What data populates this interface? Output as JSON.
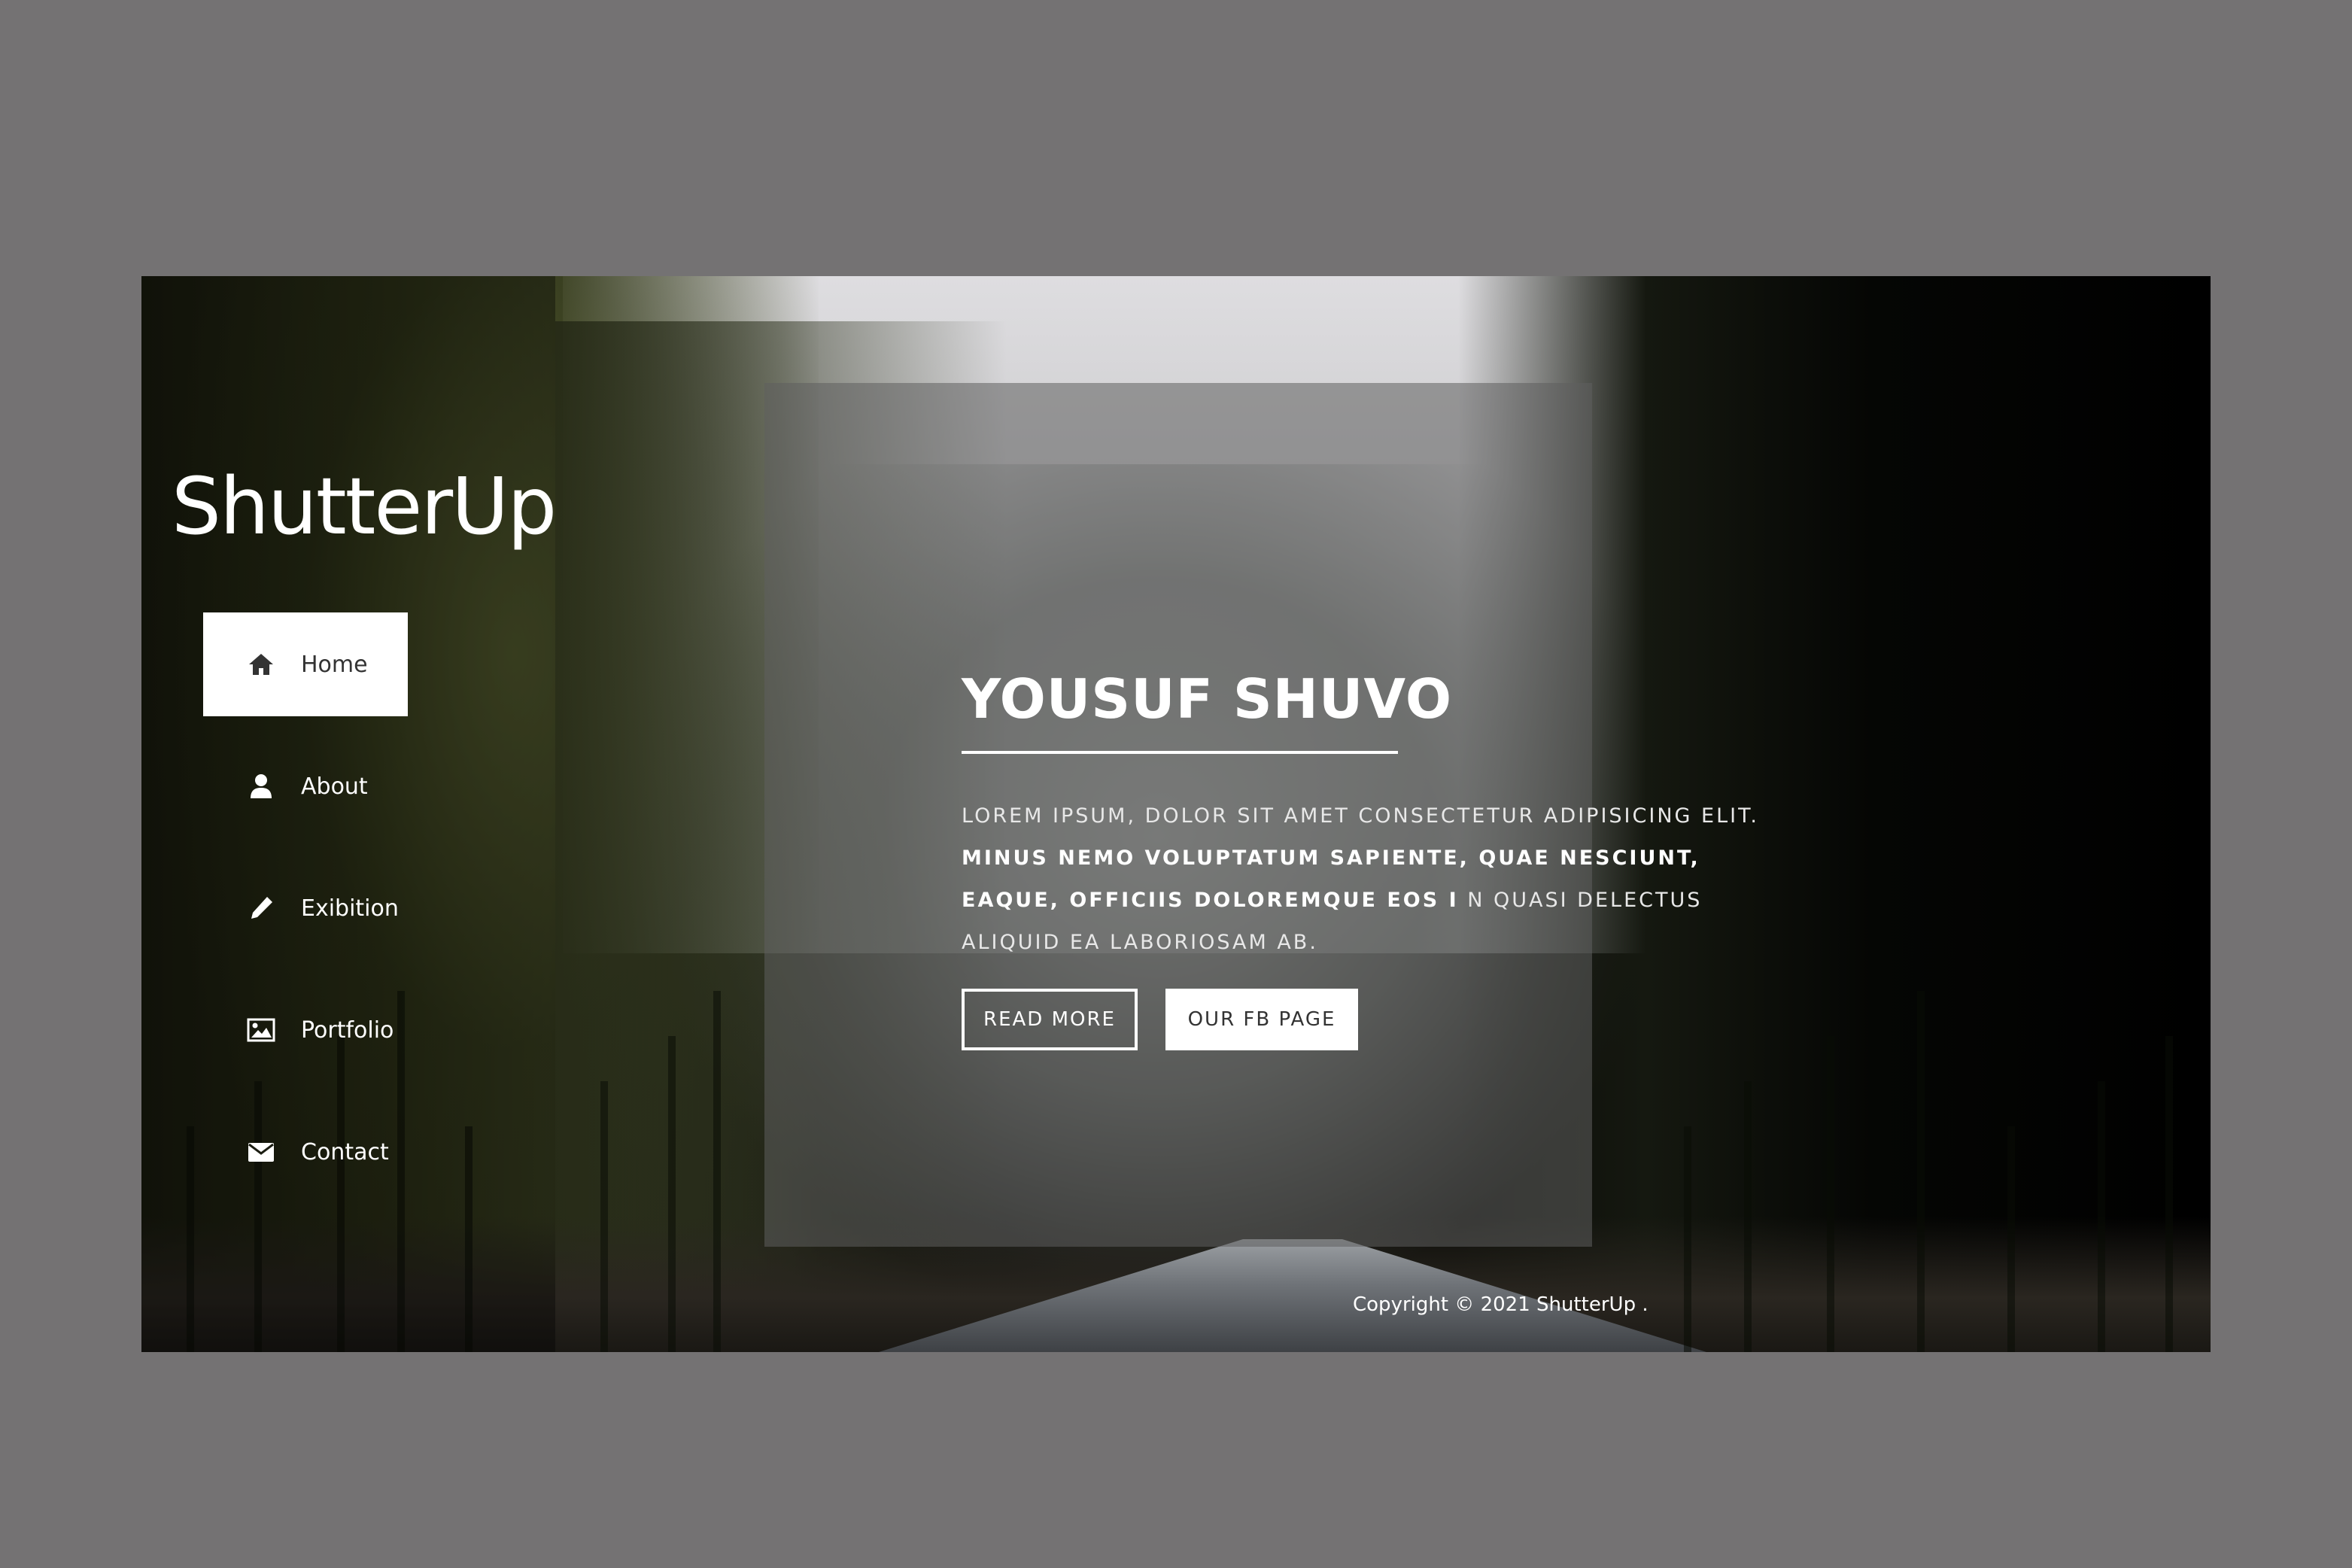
{
  "brand": {
    "logo": "ShutterUp"
  },
  "nav": {
    "items": [
      {
        "label": "Home",
        "icon": "home-icon",
        "active": true
      },
      {
        "label": "About",
        "icon": "user-icon",
        "active": false
      },
      {
        "label": "Exibition",
        "icon": "pencil-icon",
        "active": false
      },
      {
        "label": "Portfolio",
        "icon": "image-icon",
        "active": false
      },
      {
        "label": "Contact",
        "icon": "envelope-icon",
        "active": false
      }
    ]
  },
  "hero": {
    "title": "YOUSUF SHUVO",
    "text_line1": "Lorem ipsum, dolor sit amet consectetur adipisicing elit.",
    "text_bold": "Minus nemo voluptatum sapiente, quae nesciunt, eaque, officiis doloremque eos i",
    "text_rest": "n quasi delectus aliquid ea laboriosam ab.",
    "read_more": "READ MORE",
    "fb_page": "OUR FB PAGE"
  },
  "footer": {
    "copyright": "Copyright © 2021 ShutterUp ."
  },
  "colors": {
    "page_background": "#747273",
    "accent": "#ffffff",
    "panel_overlay": "rgba(95,95,95,0.55)"
  }
}
